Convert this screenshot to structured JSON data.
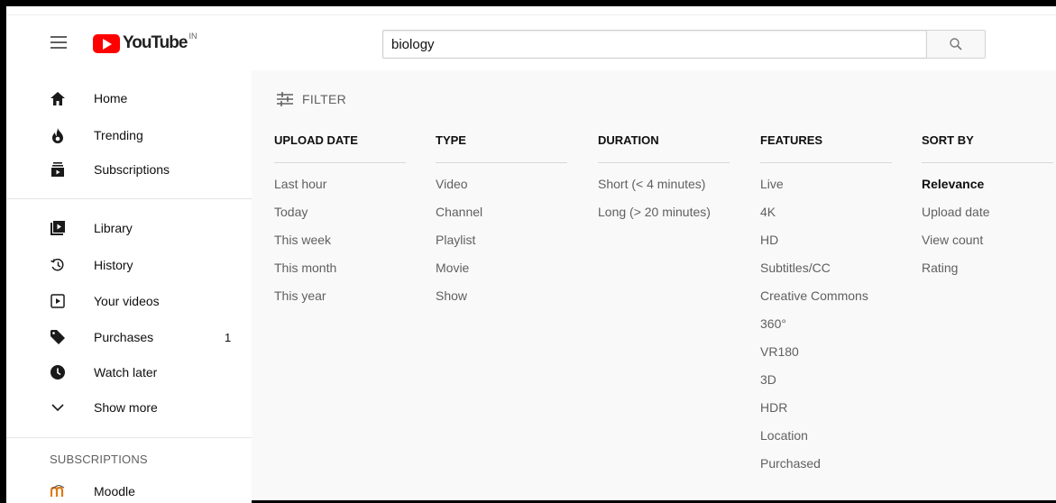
{
  "masthead": {
    "logo_text": "YouTube",
    "country_code": "IN",
    "search_value": "biology"
  },
  "sidebar": {
    "primary": [
      {
        "label": "Home",
        "icon": "home-icon"
      },
      {
        "label": "Trending",
        "icon": "flame-icon"
      },
      {
        "label": "Subscriptions",
        "icon": "subscriptions-icon"
      }
    ],
    "secondary": [
      {
        "label": "Library",
        "icon": "library-icon"
      },
      {
        "label": "History",
        "icon": "history-icon"
      },
      {
        "label": "Your videos",
        "icon": "your-videos-icon"
      },
      {
        "label": "Purchases",
        "icon": "tag-icon",
        "count": "1"
      },
      {
        "label": "Watch later",
        "icon": "clock-icon"
      },
      {
        "label": "Show more",
        "icon": "chevron-down-icon"
      }
    ],
    "subscriptions_heading": "SUBSCRIPTIONS",
    "subscriptions": [
      {
        "label": "Moodle",
        "icon": "moodle-icon"
      }
    ]
  },
  "filters": {
    "toggle_label": "FILTER",
    "columns": [
      {
        "heading": "UPLOAD DATE",
        "options": [
          "Last hour",
          "Today",
          "This week",
          "This month",
          "This year"
        ]
      },
      {
        "heading": "TYPE",
        "options": [
          "Video",
          "Channel",
          "Playlist",
          "Movie",
          "Show"
        ]
      },
      {
        "heading": "DURATION",
        "options": [
          "Short (< 4 minutes)",
          "Long (> 20 minutes)"
        ]
      },
      {
        "heading": "FEATURES",
        "options": [
          "Live",
          "4K",
          "HD",
          "Subtitles/CC",
          "Creative Commons",
          "360°",
          "VR180",
          "3D",
          "HDR",
          "Location",
          "Purchased"
        ]
      },
      {
        "heading": "SORT BY",
        "options": [
          "Relevance",
          "Upload date",
          "View count",
          "Rating"
        ],
        "selected": "Relevance"
      }
    ]
  },
  "colors": {
    "brand_red": "#ff0000",
    "panel_bg": "#f9f9f9",
    "muted_text": "#606060"
  }
}
